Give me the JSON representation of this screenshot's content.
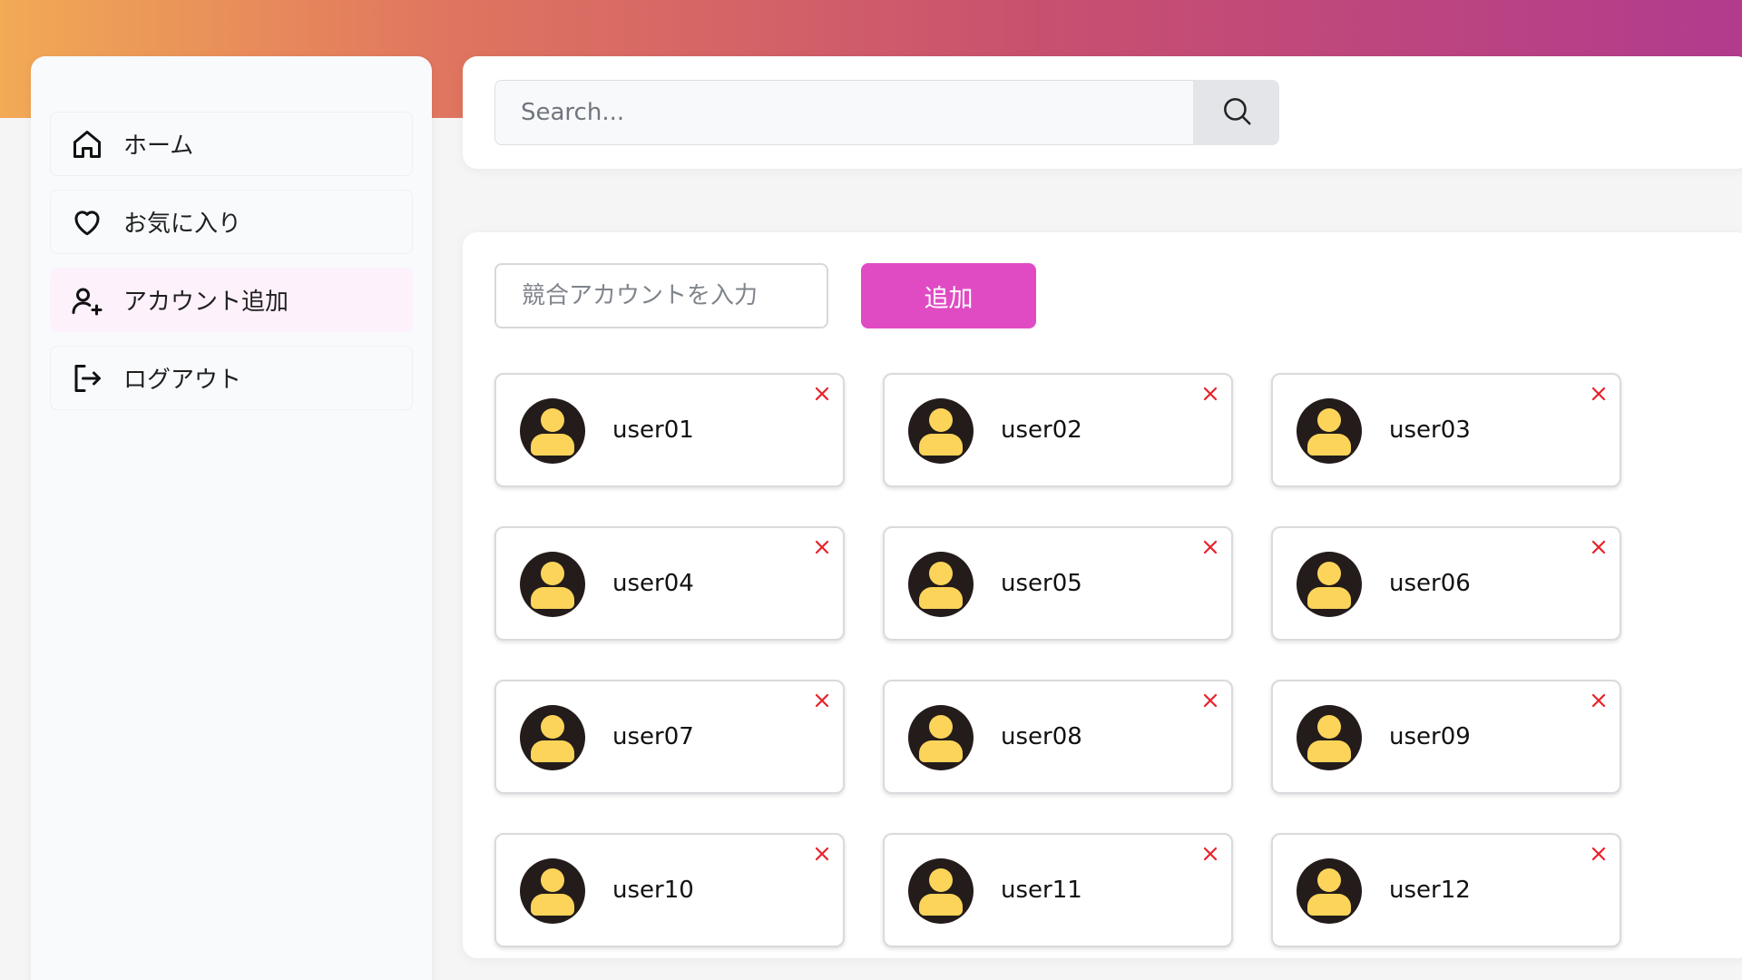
{
  "theme": {
    "accent": "#e04bc4",
    "active_bg": "#fdf1fb",
    "remove_color": "#e8222b",
    "avatar_bg": "#231c1a",
    "avatar_fg": "#fcd45a"
  },
  "sidebar": {
    "items": [
      {
        "label": "ホーム",
        "icon": "home-icon",
        "active": false
      },
      {
        "label": "お気に入り",
        "icon": "heart-icon",
        "active": false
      },
      {
        "label": "アカウント追加",
        "icon": "user-plus-icon",
        "active": true
      },
      {
        "label": "ログアウト",
        "icon": "logout-icon",
        "active": false
      }
    ]
  },
  "search": {
    "placeholder": "Search...",
    "value": "",
    "button_icon": "search-icon"
  },
  "account_form": {
    "placeholder": "競合アカウントを入力",
    "value": "",
    "add_label": "追加"
  },
  "users": [
    {
      "name": "user01"
    },
    {
      "name": "user02"
    },
    {
      "name": "user03"
    },
    {
      "name": "user04"
    },
    {
      "name": "user05"
    },
    {
      "name": "user06"
    },
    {
      "name": "user07"
    },
    {
      "name": "user08"
    },
    {
      "name": "user09"
    },
    {
      "name": "user10"
    },
    {
      "name": "user11"
    },
    {
      "name": "user12"
    }
  ]
}
